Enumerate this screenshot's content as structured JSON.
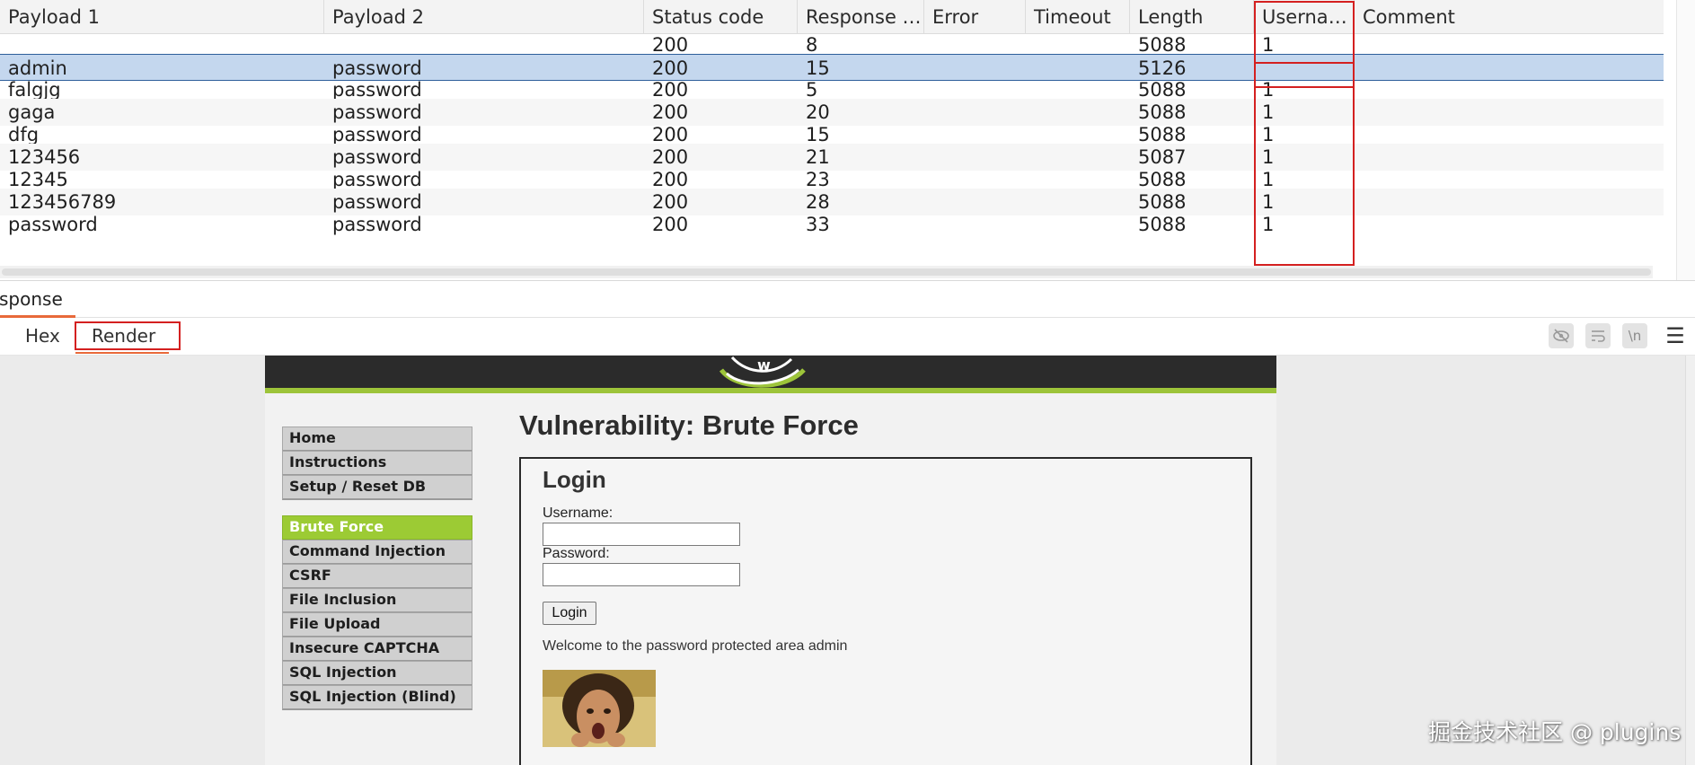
{
  "results_table": {
    "columns": [
      "Payload 1",
      "Payload 2",
      "Status code",
      "Response re...",
      "Error",
      "Timeout",
      "Length",
      "Usernam...",
      "Comment"
    ],
    "rows": [
      {
        "payload1": "",
        "payload2": "",
        "status": "200",
        "response": "8",
        "error": "",
        "timeout": "",
        "length": "5088",
        "username": "1",
        "comment": ""
      },
      {
        "payload1": "admin",
        "payload2": "password",
        "status": "200",
        "response": "15",
        "error": "",
        "timeout": "",
        "length": "5126",
        "username": "",
        "comment": ""
      },
      {
        "payload1": "falgjg",
        "payload2": "password",
        "status": "200",
        "response": "5",
        "error": "",
        "timeout": "",
        "length": "5088",
        "username": "1",
        "comment": ""
      },
      {
        "payload1": "gaga",
        "payload2": "password",
        "status": "200",
        "response": "20",
        "error": "",
        "timeout": "",
        "length": "5088",
        "username": "1",
        "comment": ""
      },
      {
        "payload1": "dfg",
        "payload2": "password",
        "status": "200",
        "response": "15",
        "error": "",
        "timeout": "",
        "length": "5088",
        "username": "1",
        "comment": ""
      },
      {
        "payload1": "123456",
        "payload2": "password",
        "status": "200",
        "response": "21",
        "error": "",
        "timeout": "",
        "length": "5087",
        "username": "1",
        "comment": ""
      },
      {
        "payload1": "12345",
        "payload2": "password",
        "status": "200",
        "response": "23",
        "error": "",
        "timeout": "",
        "length": "5088",
        "username": "1",
        "comment": ""
      },
      {
        "payload1": "123456789",
        "payload2": "password",
        "status": "200",
        "response": "28",
        "error": "",
        "timeout": "",
        "length": "5088",
        "username": "1",
        "comment": ""
      },
      {
        "payload1": "password",
        "payload2": "password",
        "status": "200",
        "response": "33",
        "error": "",
        "timeout": "",
        "length": "5088",
        "username": "1",
        "comment": ""
      }
    ],
    "selected_row": 1
  },
  "response_panel": {
    "title": "sponse",
    "tabs": [
      "Hex",
      "Render"
    ],
    "active_tab": "Render",
    "toolbar_icons": [
      "hide-icon",
      "wrap-icon",
      "newline-icon",
      "menu-icon"
    ],
    "newline_label": "\\n",
    "menu_glyph": "☰"
  },
  "dvwa": {
    "menu": [
      "Home",
      "Instructions",
      "Setup / Reset DB",
      "Brute Force",
      "Command Injection",
      "CSRF",
      "File Inclusion",
      "File Upload",
      "Insecure CAPTCHA",
      "SQL Injection",
      "SQL Injection (Blind)"
    ],
    "active_menu": "Brute Force",
    "page_title": "Vulnerability: Brute Force",
    "login": {
      "heading": "Login",
      "username_label": "Username:",
      "password_label": "Password:",
      "username_value": "",
      "password_value": "",
      "button_label": "Login",
      "welcome": "Welcome to the password protected area admin"
    }
  },
  "colors": {
    "highlight_red": "#d42020",
    "selection_blue": "#c4d7ee",
    "accent_orange": "#e8693a",
    "dvwa_green": "#9ccb34",
    "banner_dark": "#2b2b2b"
  },
  "watermark": "掘金技术社区 @ plugins"
}
